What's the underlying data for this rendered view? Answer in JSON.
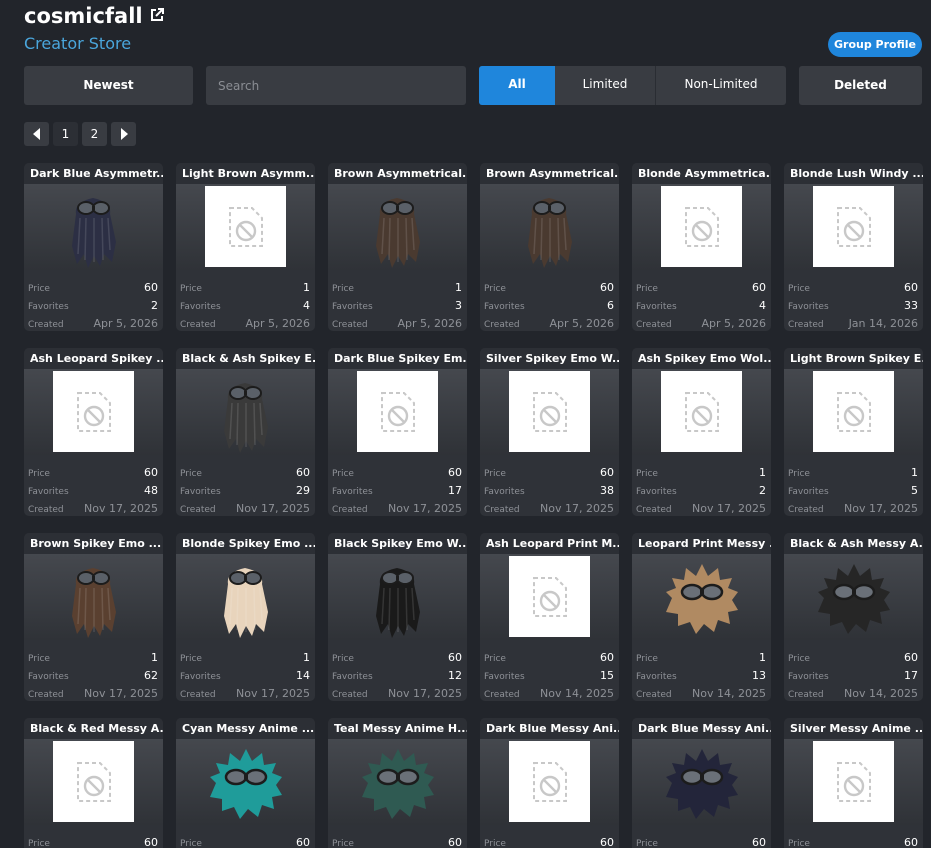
{
  "header": {
    "title": "cosmicfall",
    "subtitle": "Creator Store",
    "group_profile": "Group Profile"
  },
  "toolbar": {
    "sort_label": "Newest",
    "search_placeholder": "Search",
    "filters": [
      "All",
      "Limited",
      "Non-Limited"
    ],
    "active_filter": "All",
    "deleted_label": "Deleted"
  },
  "pager": {
    "pages": [
      "1",
      "2"
    ],
    "current": "1"
  },
  "stat_labels": {
    "price": "Price",
    "favorites": "Favorites",
    "created": "Created"
  },
  "items": [
    {
      "name": "Dark Blue Asymmetr...",
      "thumb": "hair",
      "color": "#2c2f44",
      "price": "60",
      "favorites": "2",
      "created": "Apr 5, 2026"
    },
    {
      "name": "Light Brown Asymm...",
      "thumb": "placeholder",
      "color": "",
      "price": "1",
      "favorites": "4",
      "created": "Apr 5, 2026"
    },
    {
      "name": "Brown Asymmetrical...",
      "thumb": "hair",
      "color": "#4a3a30",
      "price": "1",
      "favorites": "3",
      "created": "Apr 5, 2026"
    },
    {
      "name": "Brown Asymmetrical...",
      "thumb": "hair",
      "color": "#4a3a30",
      "price": "60",
      "favorites": "6",
      "created": "Apr 5, 2026"
    },
    {
      "name": "Blonde Asymmetrica...",
      "thumb": "placeholder",
      "color": "",
      "price": "60",
      "favorites": "4",
      "created": "Apr 5, 2026"
    },
    {
      "name": "Blonde Lush Windy ...",
      "thumb": "placeholder",
      "color": "",
      "price": "60",
      "favorites": "33",
      "created": "Jan 14, 2026"
    },
    {
      "name": "Ash Leopard Spikey ...",
      "thumb": "placeholder",
      "color": "",
      "price": "60",
      "favorites": "48",
      "created": "Nov 17, 2025"
    },
    {
      "name": "Black & Ash Spikey E...",
      "thumb": "hair",
      "color": "#3a3a3a",
      "price": "60",
      "favorites": "29",
      "created": "Nov 17, 2025"
    },
    {
      "name": "Dark Blue Spikey Em...",
      "thumb": "placeholder",
      "color": "",
      "price": "60",
      "favorites": "17",
      "created": "Nov 17, 2025"
    },
    {
      "name": "Silver Spikey Emo W...",
      "thumb": "placeholder",
      "color": "",
      "price": "60",
      "favorites": "38",
      "created": "Nov 17, 2025"
    },
    {
      "name": "Ash Spikey Emo Wol...",
      "thumb": "placeholder",
      "color": "",
      "price": "1",
      "favorites": "2",
      "created": "Nov 17, 2025"
    },
    {
      "name": "Light Brown Spikey E...",
      "thumb": "placeholder",
      "color": "",
      "price": "1",
      "favorites": "5",
      "created": "Nov 17, 2025"
    },
    {
      "name": "Brown Spikey Emo ...",
      "thumb": "hair",
      "color": "#5a4030",
      "price": "1",
      "favorites": "62",
      "created": "Nov 17, 2025"
    },
    {
      "name": "Blonde Spikey Emo ...",
      "thumb": "hair",
      "color": "#e8d4bc",
      "price": "1",
      "favorites": "14",
      "created": "Nov 17, 2025"
    },
    {
      "name": "Black Spikey Emo W...",
      "thumb": "hair",
      "color": "#1a1a1a",
      "price": "60",
      "favorites": "12",
      "created": "Nov 17, 2025"
    },
    {
      "name": "Ash Leopard Print M...",
      "thumb": "placeholder",
      "color": "",
      "price": "60",
      "favorites": "15",
      "created": "Nov 14, 2025"
    },
    {
      "name": "Leopard Print Messy ...",
      "thumb": "messy",
      "color": "#b08a62",
      "price": "1",
      "favorites": "13",
      "created": "Nov 14, 2025"
    },
    {
      "name": "Black & Ash Messy A...",
      "thumb": "messy",
      "color": "#262626",
      "price": "60",
      "favorites": "17",
      "created": "Nov 14, 2025"
    },
    {
      "name": "Black & Red Messy A...",
      "thumb": "placeholder",
      "color": "",
      "price": "60",
      "favorites": "",
      "created": ""
    },
    {
      "name": "Cyan Messy Anime ...",
      "thumb": "messy",
      "color": "#1f9c9a",
      "price": "60",
      "favorites": "",
      "created": ""
    },
    {
      "name": "Teal Messy Anime H...",
      "thumb": "messy",
      "color": "#2f5a52",
      "price": "60",
      "favorites": "",
      "created": ""
    },
    {
      "name": "Dark Blue Messy Ani...",
      "thumb": "placeholder",
      "color": "",
      "price": "60",
      "favorites": "",
      "created": ""
    },
    {
      "name": "Dark Blue Messy Ani...",
      "thumb": "messy",
      "color": "#23253a",
      "price": "60",
      "favorites": "",
      "created": ""
    },
    {
      "name": "Silver Messy Anime ...",
      "thumb": "placeholder",
      "color": "",
      "price": "60",
      "favorites": "",
      "created": ""
    }
  ],
  "colors": {
    "background": "#22252b",
    "accent": "#1f86dc",
    "subtitle": "#4aa6dc",
    "card": "#2f3238"
  }
}
